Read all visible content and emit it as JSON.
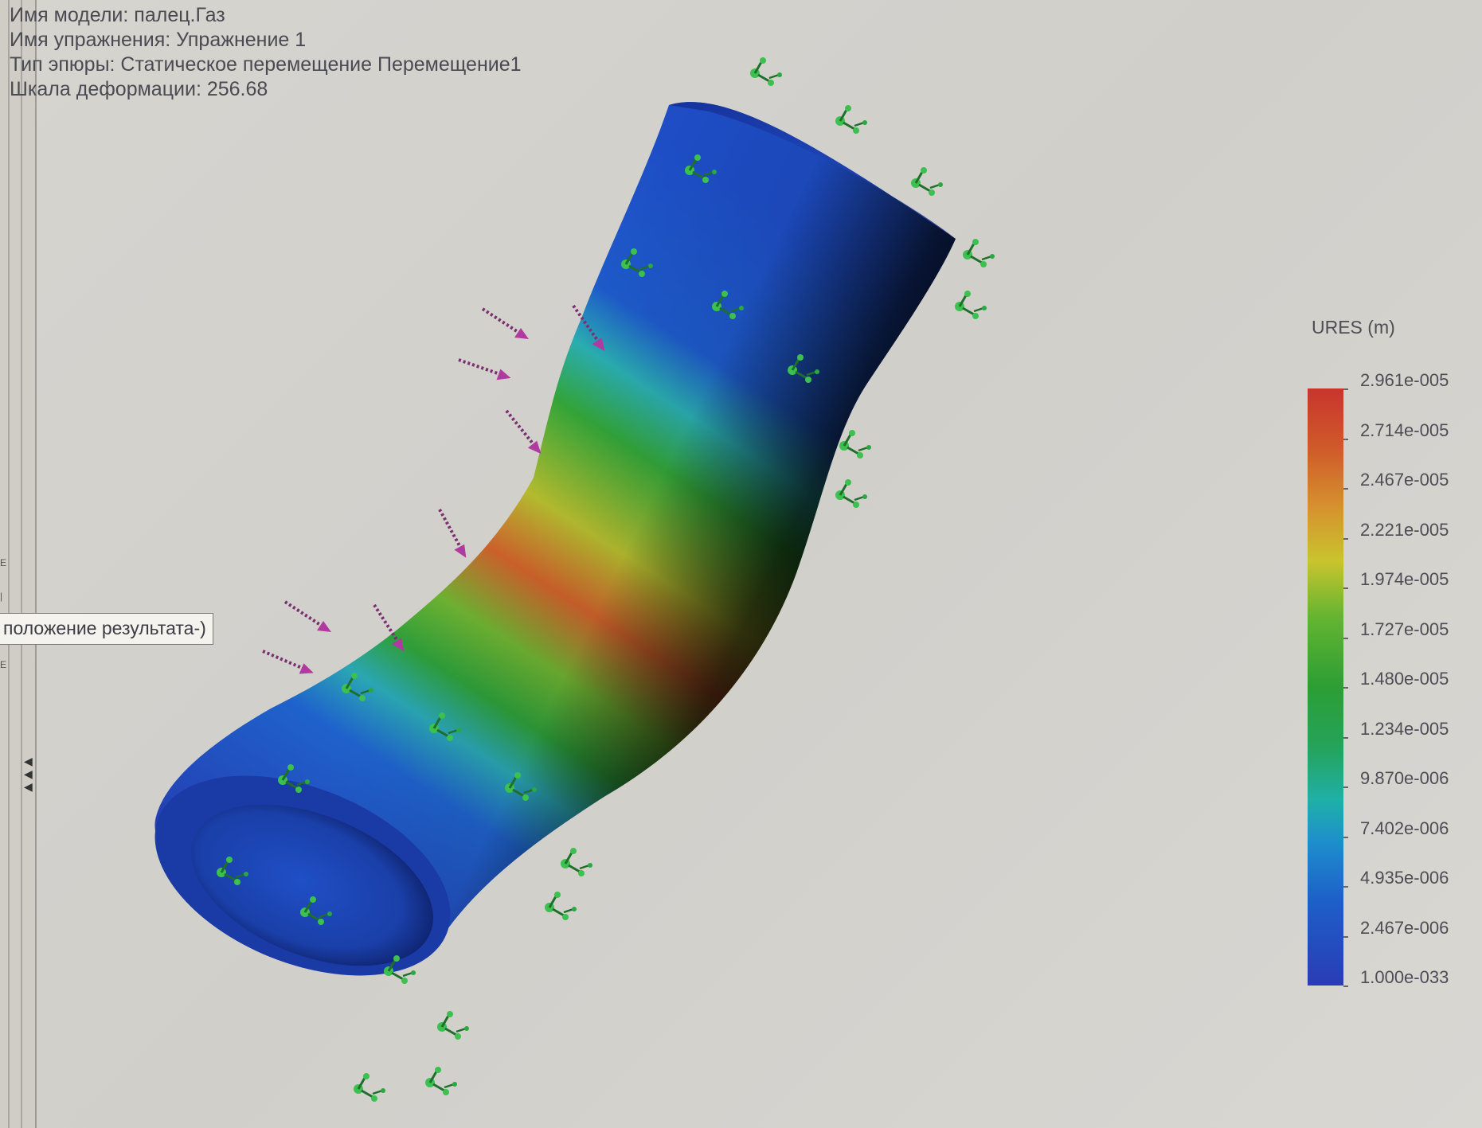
{
  "study_info": {
    "model_name": "Имя модели: палец.Газ",
    "study_name": "Имя упражнения: Упражнение 1",
    "plot_type": "Тип эпюры: Статическое перемещение Перемещение1",
    "deformation_scale": "Шкала деформации: 256.68"
  },
  "tooltip": {
    "text": "положение результата-)"
  },
  "legend": {
    "title": "URES (m)",
    "ticks": [
      "2.961e-005",
      "2.714e-005",
      "2.467e-005",
      "2.221e-005",
      "1.974e-005",
      "1.727e-005",
      "1.480e-005",
      "1.234e-005",
      "9.870e-006",
      "7.402e-006",
      "4.935e-006",
      "2.467e-006",
      "1.000e-033"
    ],
    "max": "2.961e-005",
    "min": "1.000e-033"
  },
  "colors": {
    "max_displacement": "#c8352c",
    "mid_displacement": "#2c9e34",
    "min_displacement": "#2a3cb6",
    "fixture_markers": "#2aa844",
    "load_arrows": "#9a2b8a"
  },
  "icons": {
    "fixture": "fixed-geometry-icon",
    "load": "force-arrow-icon"
  }
}
